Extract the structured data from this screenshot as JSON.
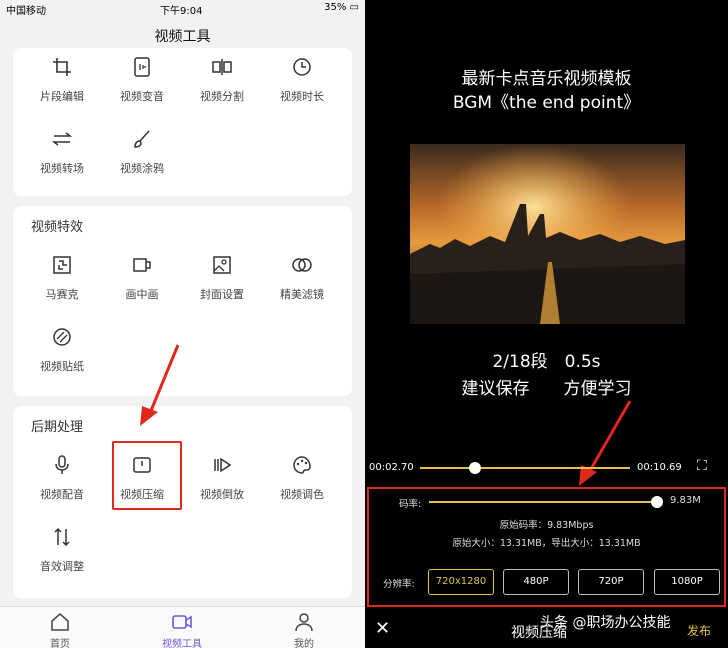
{
  "status": {
    "carrier": "中国移动",
    "time": "下午9:04",
    "battery": "35%"
  },
  "nav": {
    "title": "视频工具"
  },
  "section1": {
    "tools": [
      {
        "label": "片段编辑",
        "icon": "crop-icon"
      },
      {
        "label": "视频变音",
        "icon": "voice-change-icon"
      },
      {
        "label": "视频分割",
        "icon": "split-icon"
      },
      {
        "label": "视频时长",
        "icon": "clock-icon"
      },
      {
        "label": "视频转场",
        "icon": "transition-icon"
      },
      {
        "label": "视频涂鸦",
        "icon": "brush-icon"
      }
    ]
  },
  "section2": {
    "title": "视频特效",
    "tools": [
      {
        "label": "马赛克",
        "icon": "mosaic-icon"
      },
      {
        "label": "画中画",
        "icon": "pip-icon"
      },
      {
        "label": "封面设置",
        "icon": "cover-image-icon"
      },
      {
        "label": "精美滤镜",
        "icon": "filter-icon"
      },
      {
        "label": "视频贴纸",
        "icon": "sticker-icon"
      }
    ]
  },
  "section3": {
    "title": "后期处理",
    "tools": [
      {
        "label": "视频配音",
        "icon": "microphone-icon"
      },
      {
        "label": "视频压缩",
        "icon": "compress-icon"
      },
      {
        "label": "视频倒放",
        "icon": "reverse-play-icon"
      },
      {
        "label": "视频调色",
        "icon": "palette-icon"
      },
      {
        "label": "音效调整",
        "icon": "audio-adjust-icon"
      }
    ]
  },
  "tabs": [
    {
      "label": "首页",
      "icon": "home-icon"
    },
    {
      "label": "视频工具",
      "icon": "video-tools-icon"
    },
    {
      "label": "我的",
      "icon": "profile-icon"
    }
  ],
  "preview": {
    "title_line1": "最新卡点音乐视频模板",
    "title_line2": "BGM《the end point》",
    "caption_line1": "2/18段　0.5s",
    "caption_line2": "建议保存　　方便学习"
  },
  "timeline": {
    "current": "00:02.70",
    "total": "00:10.69",
    "progress": 0.26
  },
  "compress": {
    "bitrate_label": "码率:",
    "bitrate_value": "9.83M",
    "bitrate_fill": 1.0,
    "original_bitrate": "原始码率：9.83Mbps",
    "sizes": "原始大小：13.31MB，导出大小：13.31MB",
    "resolution_label": "分辨率:",
    "resolutions": [
      "720x1280",
      "480P",
      "720P",
      "1080P"
    ],
    "selected_resolution": "720x1280"
  },
  "bottom": {
    "title": "视频压缩",
    "publish": "发布",
    "watermark": "头条 @职场办公技能"
  },
  "colors": {
    "highlight": "#e0281e",
    "accent": "#e6c14a",
    "tab_active": "#6b5bd6"
  }
}
